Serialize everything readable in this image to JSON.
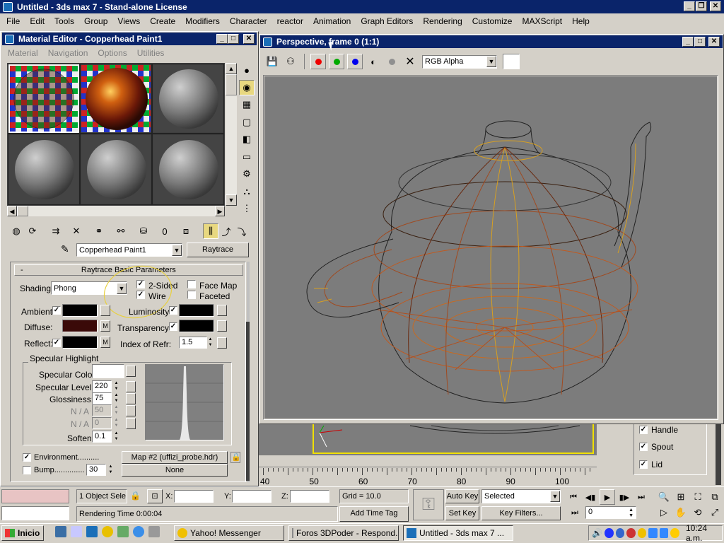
{
  "app": {
    "title": "Untitled - 3ds max 7  - Stand-alone License",
    "menu": [
      "File",
      "Edit",
      "Tools",
      "Group",
      "Views",
      "Create",
      "Modifiers",
      "Character",
      "reactor",
      "Animation",
      "Graph Editors",
      "Rendering",
      "Customize",
      "MAXScript",
      "Help"
    ]
  },
  "material_editor": {
    "title": "Material Editor - Copperhead Paint1",
    "menu": [
      "Material",
      "Navigation",
      "Options",
      "Utilities"
    ],
    "material_name": "Copperhead Paint1",
    "type_button": "Raytrace",
    "rollout_title": "Raytrace Basic Parameters",
    "rollout_collapse": "-",
    "shading_label": "Shading:",
    "shading_value": "Phong",
    "two_sided_label": "2-Sided",
    "wire_label": "Wire",
    "face_map_label": "Face Map",
    "faceted_label": "Faceted",
    "ambient_label": "Ambient:",
    "diffuse_label": "Diffuse:",
    "reflect_label": "Reflect:",
    "luminosity_label": "Luminosity:",
    "transparency_label": "Transparency:",
    "index_refr_label": "Index of Refr:",
    "index_refr_value": "1.5",
    "map_button": "M",
    "specular_group": "Specular Highlight",
    "specular_color_label": "Specular Color",
    "specular_level_label": "Specular Level:",
    "specular_level_value": "220",
    "glossiness_label": "Glossiness:",
    "glossiness_value": "75",
    "na1_label": "N / A",
    "na1_value": "50",
    "na2_label": "N / A",
    "na2_value": "0",
    "soften_label": "Soften",
    "soften_value": "0.1",
    "environment_label": "Environment..........",
    "environment_map": "Map #2 (uffizi_probe.hdr)",
    "bump_label": "Bump..............",
    "bump_value": "30",
    "bump_map": "None",
    "colors": {
      "ambient": "#000000",
      "diffuse": "#3a0a08",
      "reflect": "#000000",
      "luminosity": "#000000",
      "transparency": "#000000",
      "specular": "#ffffff"
    }
  },
  "render_window": {
    "title": "Perspective, frame 0 (1:1)",
    "channel": "RGB Alpha"
  },
  "background_panel": {
    "items": [
      "Handle",
      "Spout",
      "Lid"
    ]
  },
  "timeline": {
    "ticks": [
      "40",
      "50",
      "60",
      "70",
      "80",
      "90",
      "100"
    ]
  },
  "status": {
    "selection": "1 Object Sele",
    "x_label": "X:",
    "y_label": "Y:",
    "z_label": "Z:",
    "grid": "Grid = 10.0",
    "rendering_time": "Rendering Time  0:00:04",
    "add_time_tag": "Add Time Tag",
    "auto_key": "Auto Key",
    "set_key": "Set Key",
    "selected": "Selected",
    "key_filters": "Key Filters...",
    "frame": "0"
  },
  "taskbar": {
    "start": "Inicio",
    "tasks": [
      "Yahoo! Messenger",
      "Foros 3DPoder - Respond...",
      "Untitled - 3ds max 7  ..."
    ],
    "clock": "10:24 a.m."
  }
}
